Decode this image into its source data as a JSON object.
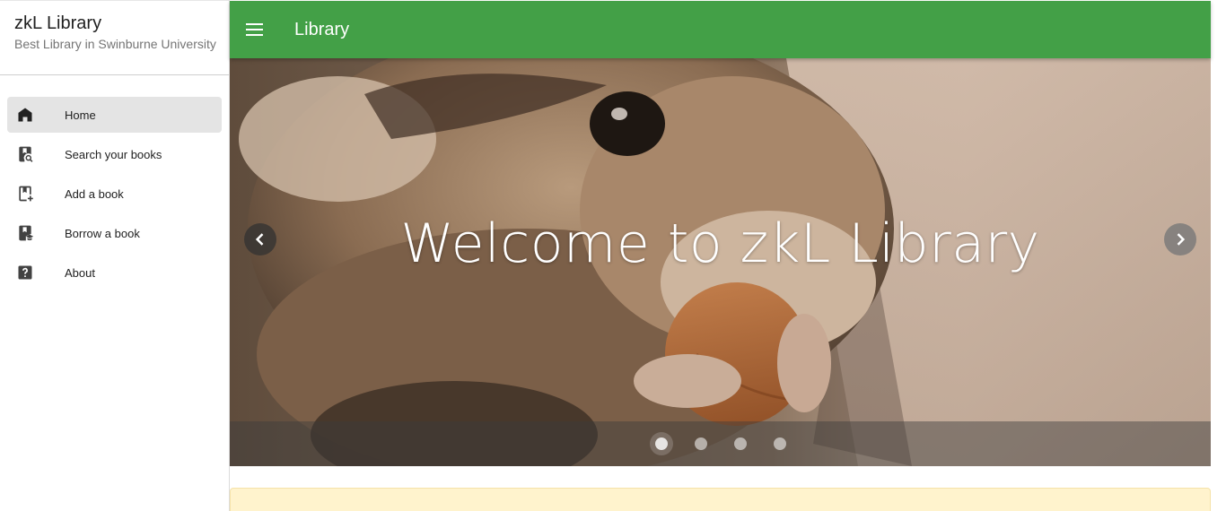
{
  "sidebar": {
    "brand_title": "zkL Library",
    "brand_subtitle": "Best Library in Swinburne University",
    "items": [
      {
        "label": "Home",
        "icon": "home-icon",
        "active": true
      },
      {
        "label": "Search your books",
        "icon": "book-search-icon",
        "active": false
      },
      {
        "label": "Add a book",
        "icon": "book-plus-icon",
        "active": false
      },
      {
        "label": "Borrow a book",
        "icon": "book-education-icon",
        "active": false
      },
      {
        "label": "About",
        "icon": "help-box-icon",
        "active": false
      }
    ]
  },
  "topbar": {
    "title": "Library",
    "menu_icon": "menu-icon",
    "color": "#43a047"
  },
  "carousel": {
    "slide_title": "Welcome to zkL Library",
    "prev_icon": "chevron-left-icon",
    "next_icon": "chevron-right-icon",
    "slide_count": 4,
    "active_slide": 1
  },
  "colors": {
    "accent": "#43a047",
    "icon": "#424242",
    "notice_background": "#fff3cd",
    "active_item": "#e4e4e4"
  }
}
